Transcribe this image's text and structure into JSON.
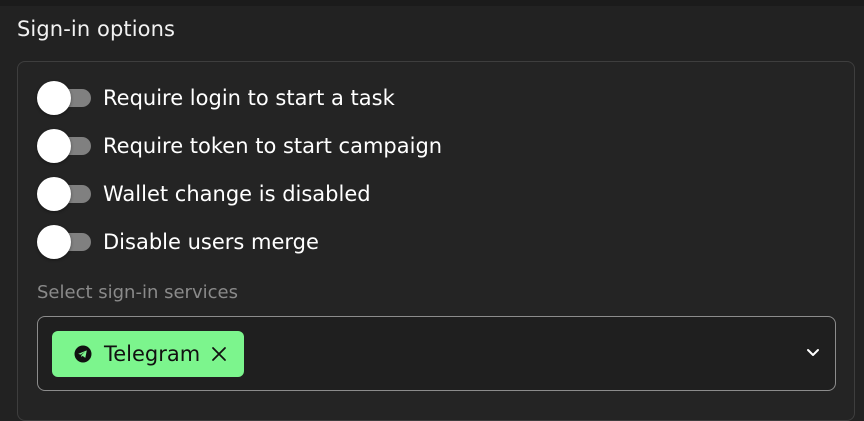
{
  "section": {
    "title": "Sign-in options"
  },
  "options": [
    {
      "label": "Require login to start a task",
      "enabled": false
    },
    {
      "label": "Require token to start campaign",
      "enabled": false
    },
    {
      "label": "Wallet change is disabled",
      "enabled": false
    },
    {
      "label": "Disable users merge",
      "enabled": false
    }
  ],
  "services": {
    "label": "Select sign-in services",
    "selected": [
      {
        "label": "Telegram",
        "icon": "telegram-icon"
      }
    ],
    "dropdown_icon": "chevron-down-icon"
  },
  "colors": {
    "background": "#222222",
    "chip_background": "#7cf58d",
    "toggle_track": "#808080",
    "toggle_knob": "#ffffff",
    "muted_text": "#8a8a8a"
  }
}
